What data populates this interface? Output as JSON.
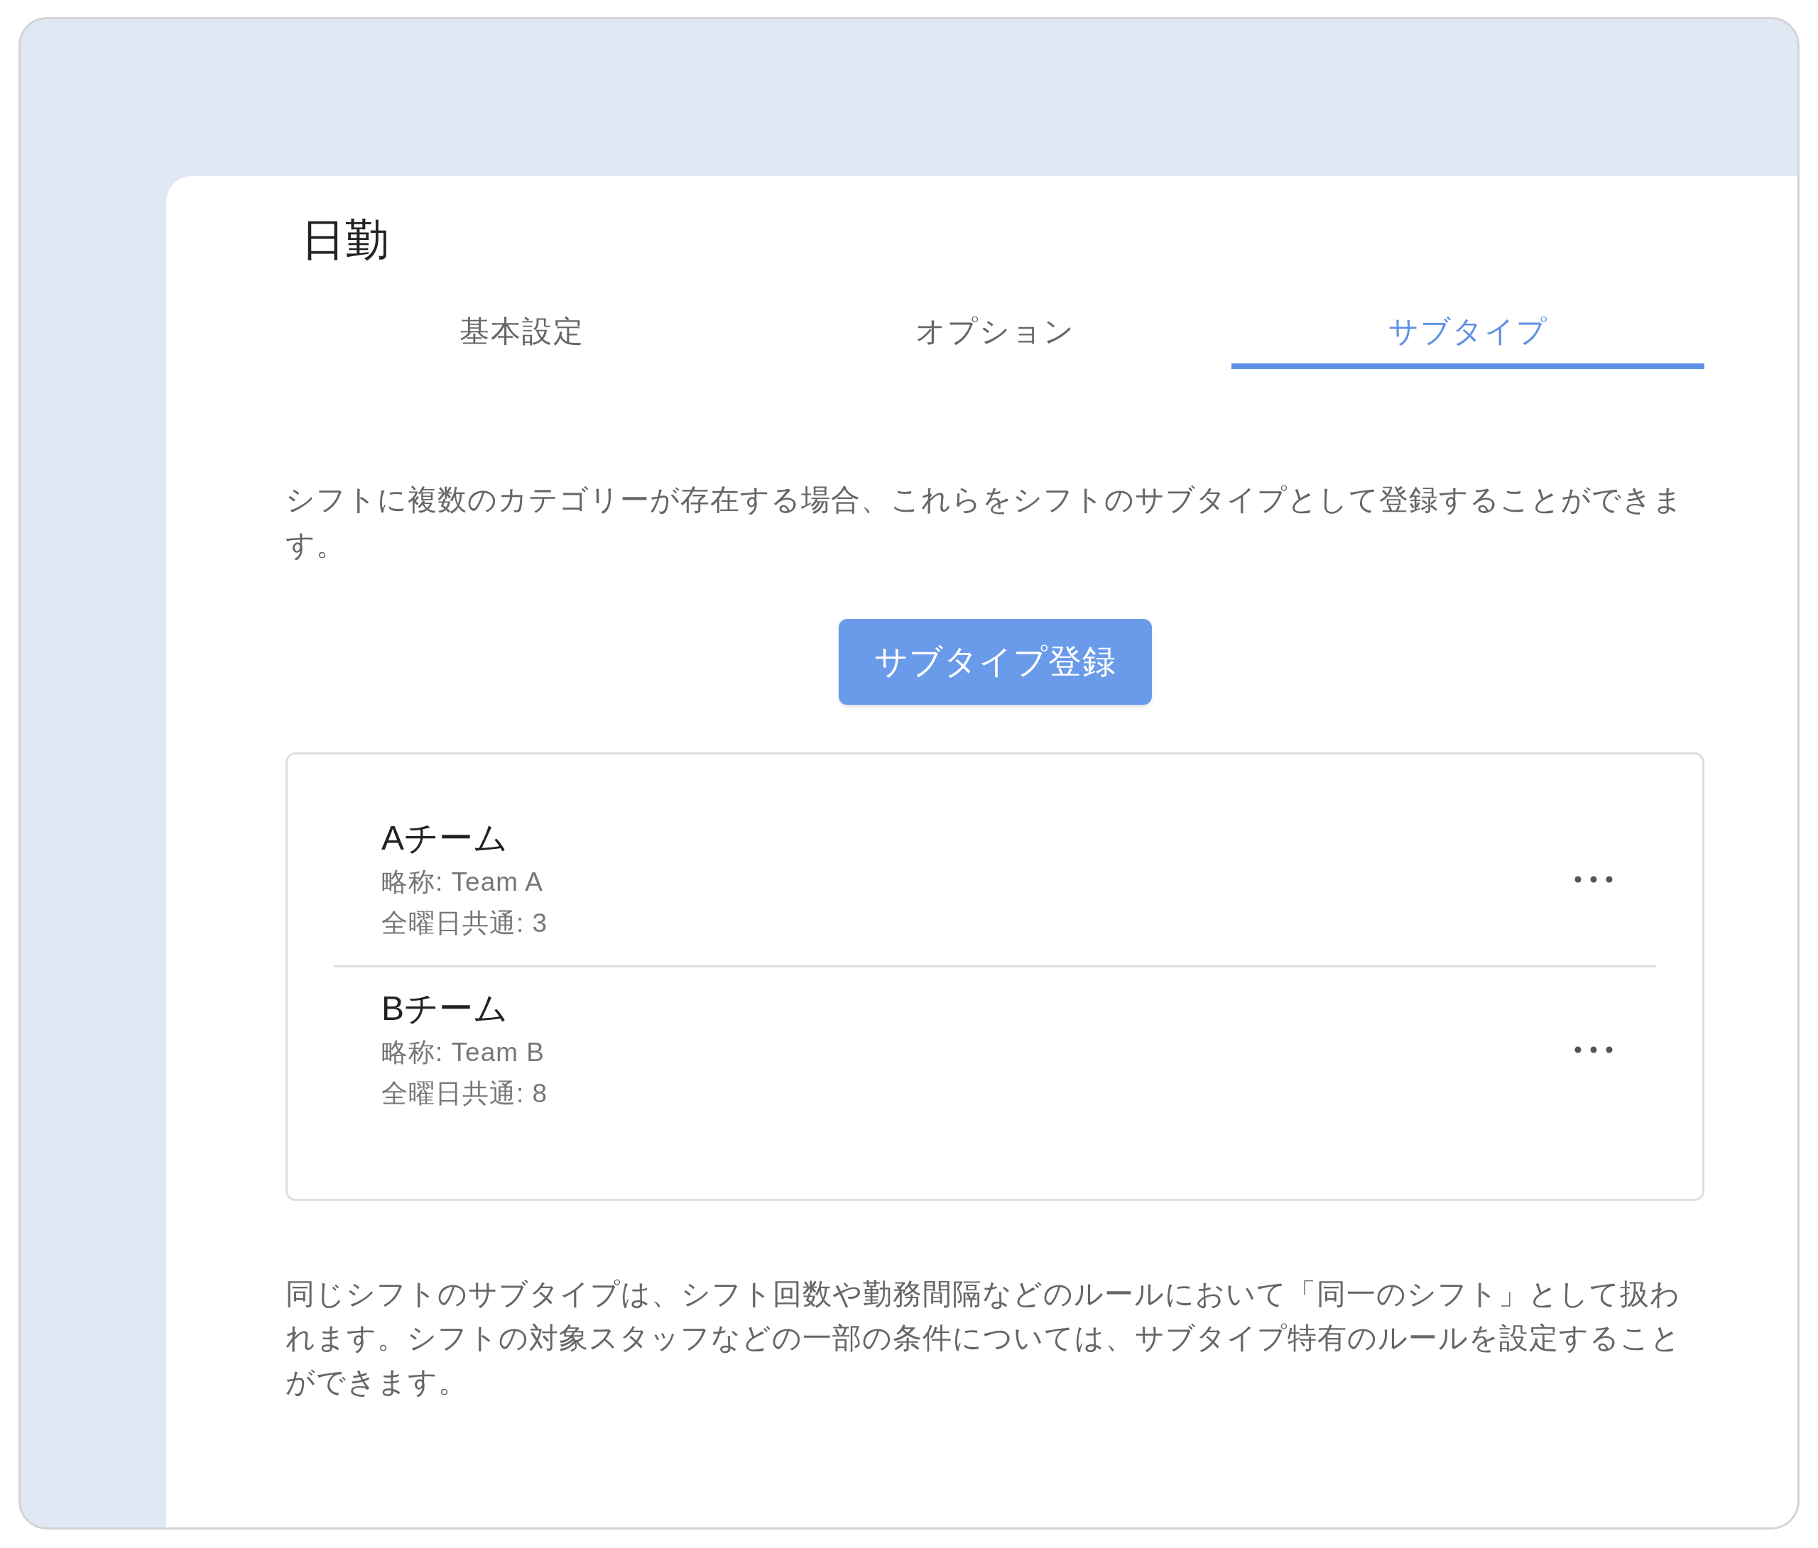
{
  "title": "日勤",
  "tabs": [
    {
      "label": "基本設定",
      "selected": false
    },
    {
      "label": "オプション",
      "selected": false
    },
    {
      "label": "サブタイプ",
      "selected": true
    }
  ],
  "description": "シフトに複数のカテゴリーが存在する場合、これらをシフトのサブタイプとして登録することができます。",
  "register_button": "サブタイプ登録",
  "subtypes": [
    {
      "name": "Aチーム",
      "abbreviation": "略称: Team A",
      "all_days": "全曜日共通: 3"
    },
    {
      "name": "Bチーム",
      "abbreviation": "略称: Team B",
      "all_days": "全曜日共通: 8"
    }
  ],
  "footer_note": "同じシフトのサブタイプは、シフト回数や勤務間隔などのルールにおいて「同一のシフト」として扱われます。シフトの対象スタッフなどの一部の条件については、サブタイプ特有のルールを設定することができます。"
}
